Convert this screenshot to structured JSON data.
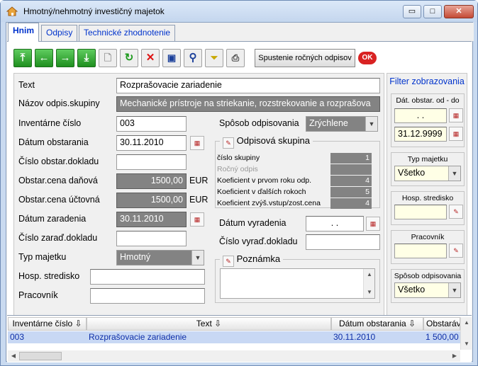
{
  "window": {
    "title": "Hmotný/nehmotný investičný majetok",
    "btn_minimize": "▭",
    "btn_maximize": "□",
    "btn_close": "✕"
  },
  "tabs": [
    {
      "label": "Hnim"
    },
    {
      "label": "Odpisy"
    },
    {
      "label": "Technické zhodnotenie"
    }
  ],
  "toolbar": {
    "run_label": "Spustenie ročných odpisov",
    "ok_label": "OK"
  },
  "form": {
    "text_label": "Text",
    "text_value": "Rozprašovacie zariadenie",
    "nazov_label": "Názov odpis.skupiny",
    "nazov_value": "Mechanické prístroje na striekanie, rozstrekovanie a rozprašova",
    "inv_label": "Inventárne číslo",
    "inv_value": "003",
    "dat_obst_label": "Dátum obstarania",
    "dat_obst_value": "30.11.2010",
    "cislo_obst_label": "Číslo obstar.dokladu",
    "cislo_obst_value": "",
    "cena_danova_label": "Obstar.cena daňová",
    "cena_danova_value": "1500,00",
    "cena_uctovna_label": "Obstar.cena účtovná",
    "cena_uctovna_value": "1500,00",
    "currency": "EUR",
    "dat_zar_label": "Dátum zaradenia",
    "dat_zar_value": "30.11.2010",
    "cislo_zar_label": "Číslo zaraď.dokladu",
    "cislo_zar_value": "",
    "typ_label": "Typ majetku",
    "typ_value": "Hmotný",
    "hosp_label": "Hosp. stredisko",
    "hosp_value": "",
    "prac_label": "Pracovník",
    "prac_value": "",
    "sposob_label": "Spôsob odpisovania",
    "sposob_value": "Zrýchlene",
    "odp_skupina_title": "Odpisová skupina",
    "odp_rows": [
      {
        "label": "číslo skupiny",
        "value": "1"
      },
      {
        "label": "Ročný odpis",
        "value": ""
      },
      {
        "label": "Koeficient v prvom roku odp.",
        "value": "4"
      },
      {
        "label": "Koeficient v ďalších rokoch",
        "value": "5"
      },
      {
        "label": "Koeficient zvýš.vstup/zost.cena",
        "value": "4"
      }
    ],
    "dat_vyr_label": "Dátum vyradenia",
    "dat_vyr_value": ". .",
    "cislo_vyr_label": "Číslo vyraď.dokladu",
    "cislo_vyr_value": "",
    "poznamka_title": "Poznámka"
  },
  "filter": {
    "title": "Filter zobrazovania",
    "dat_title": "Dát. obstar. od - do",
    "dat_from": ". .",
    "dat_to": "31.12.9999",
    "typ_title": "Typ majetku",
    "typ_value": "Všetko",
    "hosp_title": "Hosp. stredisko",
    "prac_title": "Pracovník",
    "sposob_title": "Spôsob odpisovania",
    "sposob_value": "Všetko"
  },
  "table": {
    "columns": [
      "Inventárne číslo",
      "Text",
      "Dátum obstarania",
      "Obstaráva"
    ],
    "rows": [
      {
        "inv": "003",
        "text": "Rozprašovacie zariadenie",
        "date": "30.11.2010",
        "price": "1 500,00"
      }
    ]
  }
}
